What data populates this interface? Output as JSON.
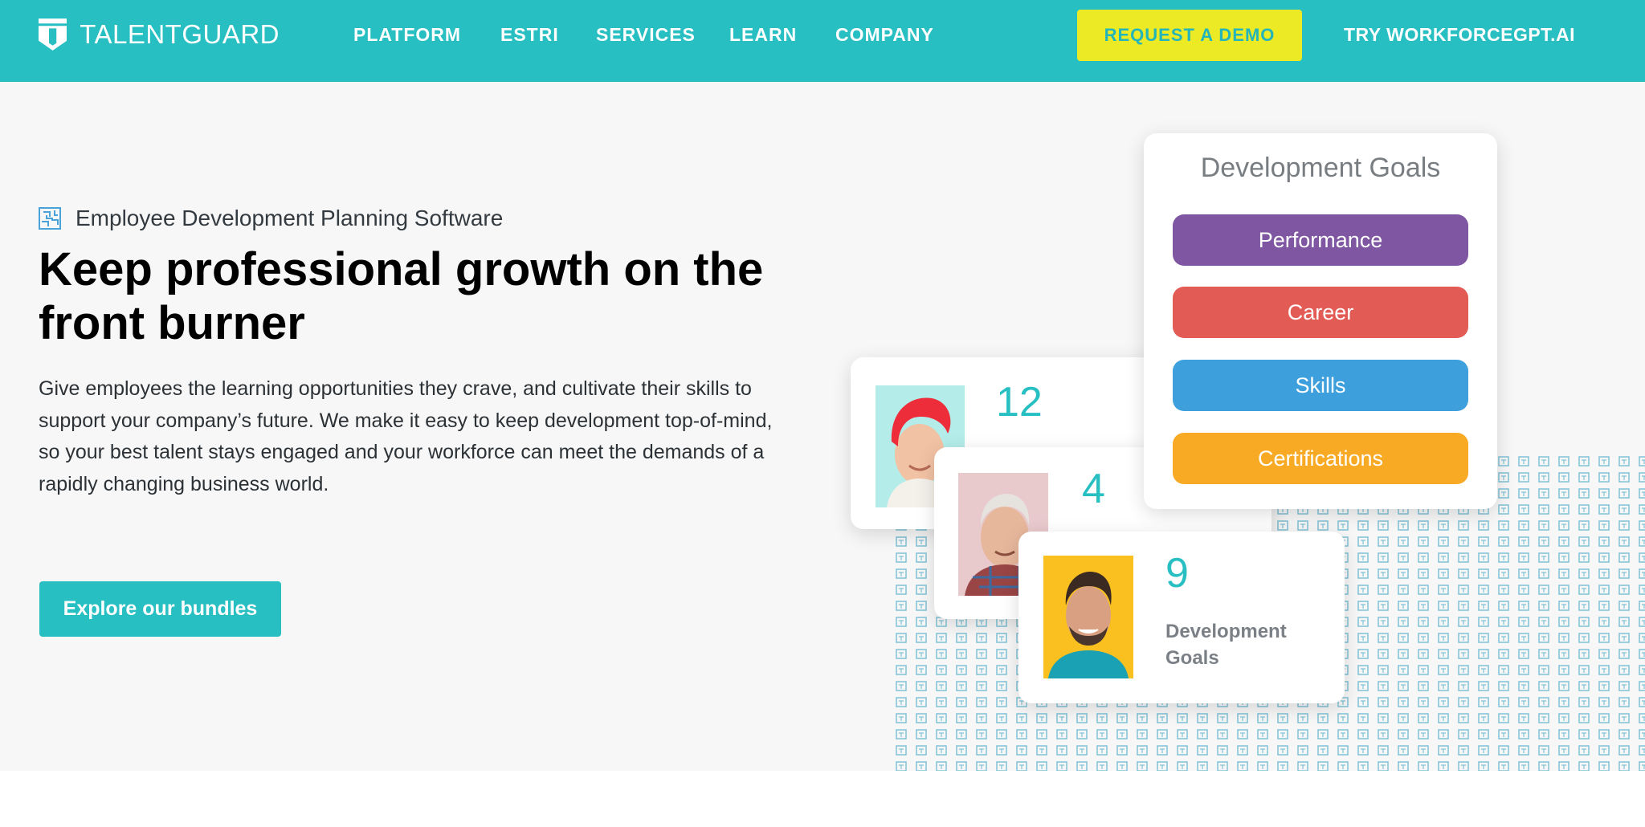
{
  "nav": {
    "logo_text": "TALENTGUARD",
    "items": [
      "PLATFORM",
      "ESTRI",
      "SERVICES",
      "LEARN",
      "COMPANY"
    ],
    "demo_label": "REQUEST A DEMO",
    "try_label": "TRY WORKFORCEGPT.AI"
  },
  "hero": {
    "eyebrow": "Employee Development Planning Software",
    "headline": "Keep professional growth on the front burner",
    "lead": "Give employees the learning opportunities they crave, and cultivate their skills to support your company’s future. We make it easy to keep development top-of-mind, so your best talent stays engaged and your workforce can meet the demands of a rapidly changing business world.",
    "cta_label": "Explore our bundles"
  },
  "illustration": {
    "employee_cards": [
      {
        "count": "12"
      },
      {
        "count": "4"
      },
      {
        "count": "9",
        "label": "Development Goals"
      }
    ],
    "goals_panel": {
      "title": "Development Goals",
      "goals": [
        "Performance",
        "Career",
        "Skills",
        "Certifications"
      ]
    }
  },
  "colors": {
    "brand_teal": "#28bfc2",
    "demo_yellow": "#ecea24",
    "performance": "#7f56a2",
    "career": "#e35b55",
    "skills": "#3d9fdc",
    "certifications": "#f9aa25"
  }
}
